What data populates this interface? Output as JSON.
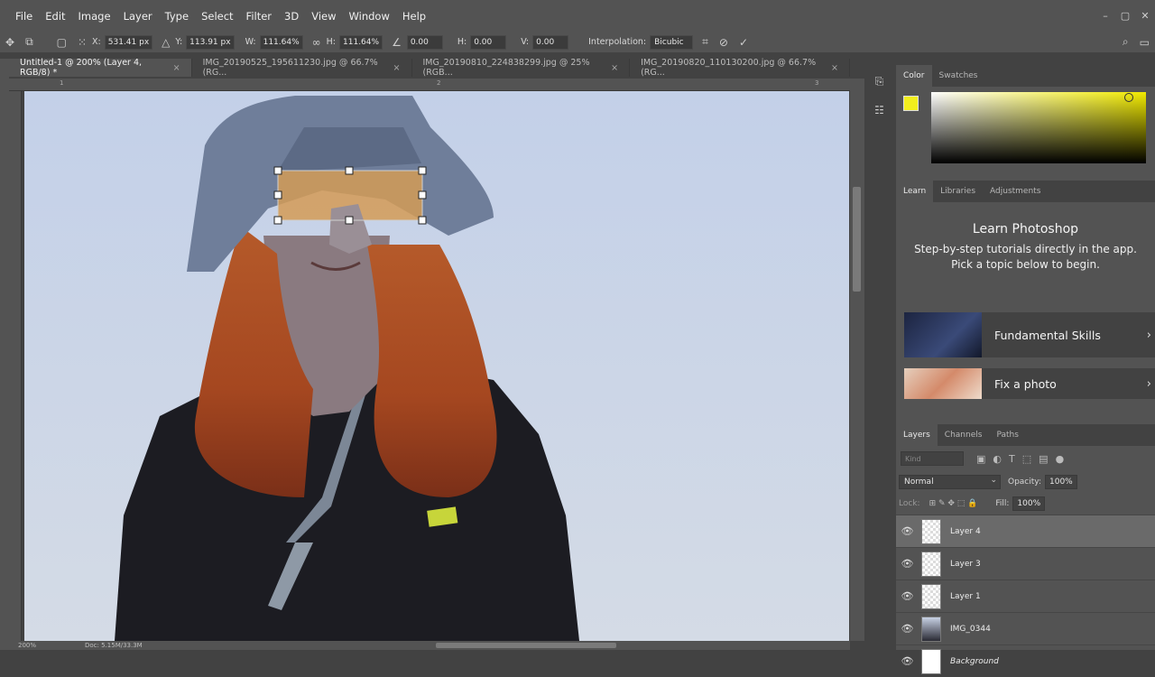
{
  "menu": [
    "File",
    "Edit",
    "Image",
    "Layer",
    "Type",
    "Select",
    "Filter",
    "3D",
    "View",
    "Window",
    "Help"
  ],
  "window_controls": [
    "–",
    "▢",
    "✕"
  ],
  "options": {
    "x_label": "X:",
    "x_value": "531.41 px",
    "y_label": "Y:",
    "y_value": "113.91 px",
    "w_label": "W:",
    "w_value": "111.64%",
    "h_label": "H:",
    "h_value": "111.64%",
    "angle_value": "0.00",
    "hskew_label": "H:",
    "hskew_value": "0.00",
    "vskew_label": "V:",
    "vskew_value": "0.00",
    "interp_label": "Interpolation:",
    "interp_value": "Bicubic"
  },
  "tabs": [
    {
      "label": "Untitled-1 @ 200% (Layer 4, RGB/8) *",
      "close": "×"
    },
    {
      "label": "IMG_20190525_195611230.jpg @ 66.7% (RG...",
      "close": "×"
    },
    {
      "label": "IMG_20190810_224838299.jpg @ 25% (RGB...",
      "close": "×"
    },
    {
      "label": "IMG_20190820_110130200.jpg @ 66.7% (RG...",
      "close": "×"
    }
  ],
  "ruler": [
    "1",
    "2",
    "3"
  ],
  "status": {
    "zoom": "200%",
    "doc": "Doc: 5.15M/33.3M"
  },
  "color_panel": {
    "tabs": [
      "Color",
      "Swatches"
    ],
    "foreground": "#f2ee1d"
  },
  "learn_panel": {
    "tabs": [
      "Learn",
      "Libraries",
      "Adjustments"
    ],
    "title": "Learn Photoshop",
    "subtitle": "Step-by-step tutorials directly in the app. Pick a topic below to begin.",
    "cards": [
      "Fundamental Skills",
      "Fix a photo"
    ]
  },
  "layers_panel": {
    "tabs": [
      "Layers",
      "Channels",
      "Paths"
    ],
    "kind_placeholder": "Kind",
    "blend_mode": "Normal",
    "opacity_label": "Opacity:",
    "opacity": "100%",
    "lock_label": "Lock:",
    "fill_label": "Fill:",
    "fill": "100%",
    "layers": [
      "Layer 4",
      "Layer 3",
      "Layer 1",
      "IMG_0344",
      "Background"
    ]
  }
}
